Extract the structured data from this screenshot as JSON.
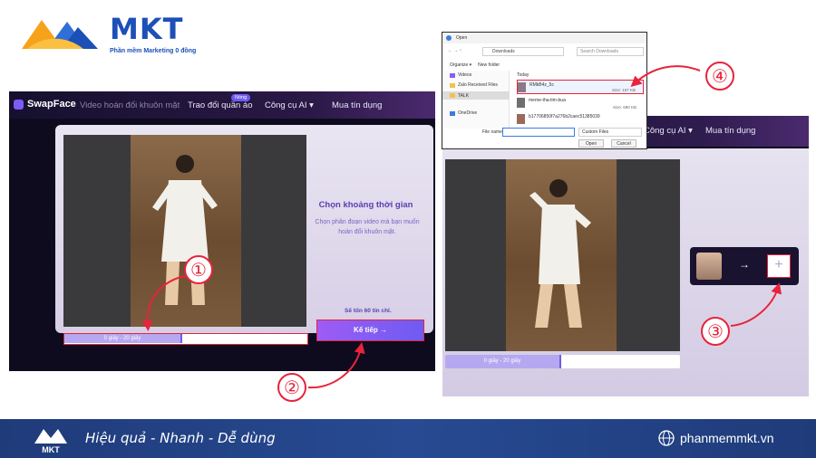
{
  "logo": {
    "name": "MKT",
    "subtitle": "Phần mềm Marketing 0 đồng"
  },
  "app1": {
    "brand": "SwapFace",
    "nav": [
      "Video hoán đổi khuôn mặt",
      "Trao đổi quần áo",
      "Công cụ AI",
      "Mua tín dụng"
    ],
    "badge": "Nóng",
    "panel_title": "Chọn khoảng thời gian",
    "panel_desc": "Chọn phân đoạn video mà bạn muốn hoán đổi khuôn mặt.",
    "credits": "Sẽ tốn 60 tín chỉ.",
    "range_label": "0 giây - 20 giây",
    "next_label": "Kế tiếp →"
  },
  "app2": {
    "nav": [
      "Công cụ AI",
      "Mua tín dụng"
    ],
    "range_label": "0 giây - 20 giây",
    "arrow": "→",
    "plus": "+"
  },
  "dialog": {
    "title": "Open",
    "address": "Downloads",
    "search_placeholder": "Search Downloads",
    "organize": "Organize ▾",
    "new_folder": "New folder",
    "sidebar": [
      "Videos",
      "Zalo Received Files",
      "TALK",
      "OneDrive"
    ],
    "section": "Today",
    "files": [
      {
        "name": "RMkB4z_5c",
        "size": "Size: 167 KB"
      },
      {
        "name": "meme-tha-tim-bua",
        "size": "Size: 690 KB"
      },
      {
        "name": "b17706850f7a276b2caec51385039",
        "size": ""
      }
    ],
    "file_name_label": "File name:",
    "file_type": "Custom Files",
    "open": "Open",
    "cancel": "Cancel"
  },
  "steps": [
    "①",
    "②",
    "③",
    "④"
  ],
  "footer": {
    "tagline": "Hiệu quả - Nhanh - Dễ dùng",
    "site": "phanmemmkt.vn"
  },
  "colors": {
    "accent": "#6d5cf2",
    "highlight": "#e8233b",
    "footer": "#274a92",
    "brand_blue": "#1d4fb8"
  }
}
